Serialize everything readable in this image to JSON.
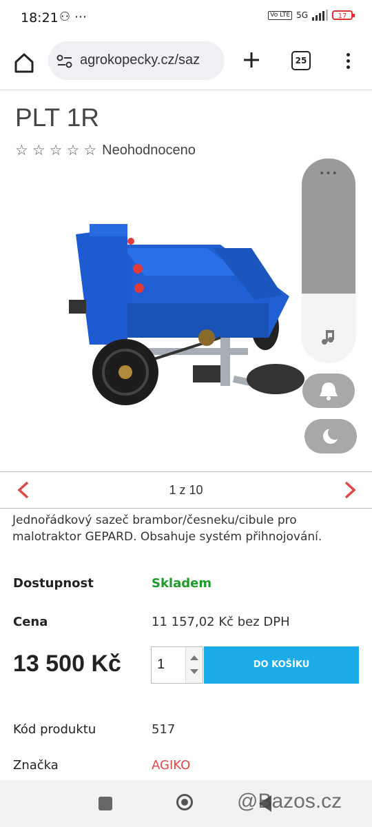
{
  "status_bar": {
    "time": "18:21",
    "left_icons": "⚇ ⋯",
    "network": "5G",
    "volte": "Vo LTE",
    "battery": "17"
  },
  "browser": {
    "url": "agrokopecky.cz/saz",
    "tab_count": "25"
  },
  "product": {
    "title": "PLT 1R",
    "stars": [
      "☆",
      "☆",
      "☆",
      "☆",
      "☆"
    ],
    "rating_text": "Neohodnoceno",
    "image_colors": {
      "body": "#1f5fd1",
      "frame": "#9aa0a8",
      "wheel": "#222222"
    },
    "gallery_counter": "1 z 10",
    "description": "Jednořádkový sazeč brambor/česneku/cibule pro malotraktor GEPARD. Obsahuje systém přihnojování.",
    "availability_label": "Dostupnost",
    "availability_value": "Skladem",
    "price_label": "Cena",
    "price_without_vat": "11 157,02 Kč bez DPH",
    "price": "13 500 Kč",
    "quantity": "1",
    "add_to_cart": "DO KOŠÍKU",
    "code_label": "Kód produktu",
    "code_value": "517",
    "brand_label": "Značka",
    "brand_value": "AGIKO"
  },
  "side_panel": {
    "dots": "•••",
    "icons": [
      "music-note-icon",
      "bell-icon",
      "moon-icon"
    ]
  },
  "watermark": "@Bazos.cz",
  "colors": {
    "accent": "#1aabe8",
    "in_stock": "#1e9a2a",
    "brand_link": "#e04848",
    "nav_arrow": "#e04848"
  }
}
